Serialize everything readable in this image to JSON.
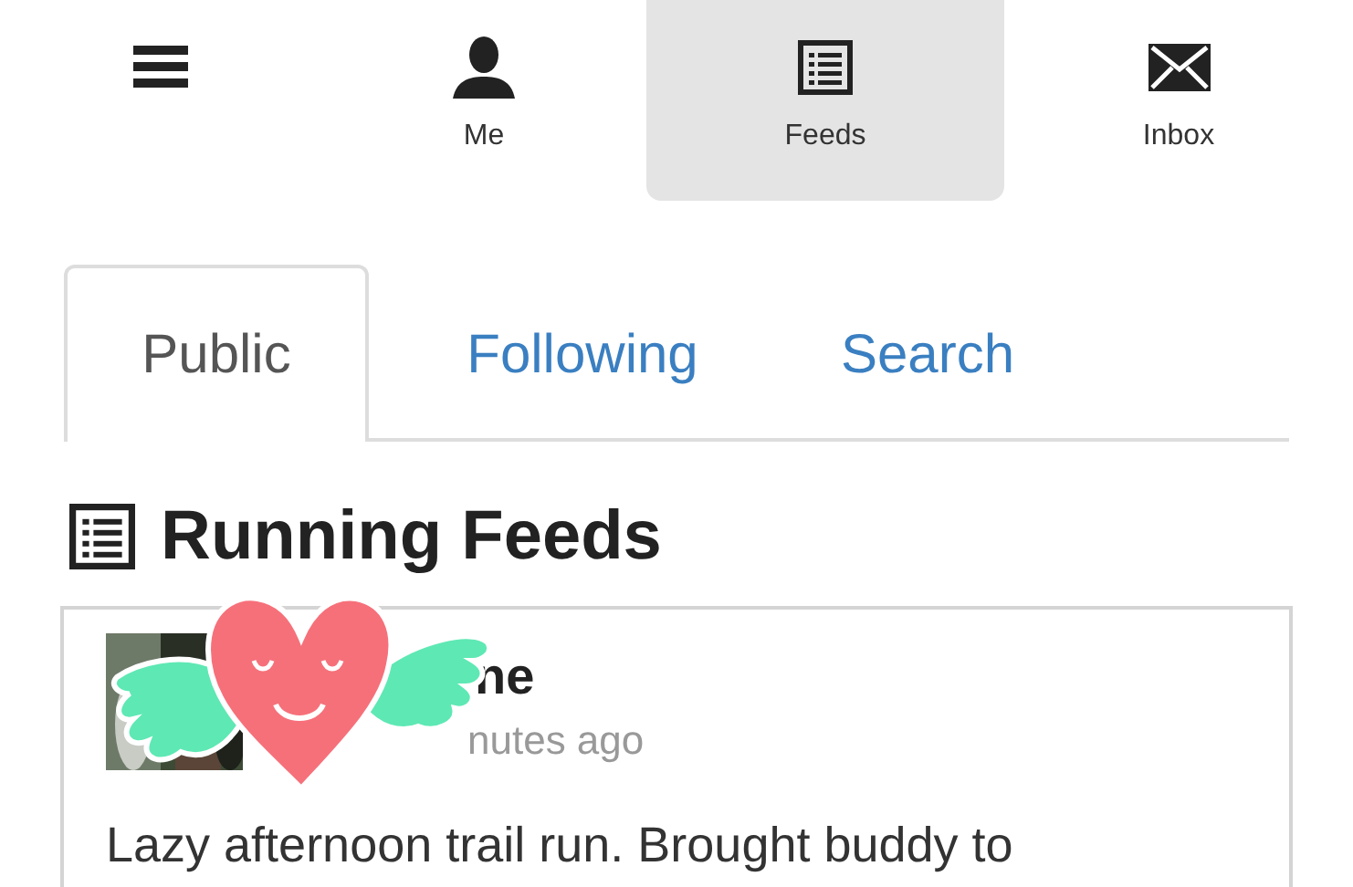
{
  "nav": {
    "items": [
      {
        "kind": "menu",
        "selected": false
      },
      {
        "kind": "person",
        "label": "Me",
        "selected": false
      },
      {
        "kind": "list",
        "label": "Feeds",
        "selected": true
      },
      {
        "kind": "mail",
        "label": "Inbox",
        "selected": false
      }
    ]
  },
  "tabs": [
    {
      "label": "Public",
      "selected": true
    },
    {
      "label": "Following",
      "selected": false
    },
    {
      "label": "Search",
      "selected": false
    }
  ],
  "heading": "Running Feeds",
  "post": {
    "name": "ne",
    "time": "nutes ago",
    "text": "Lazy afternoon trail run. Brought buddy to"
  }
}
